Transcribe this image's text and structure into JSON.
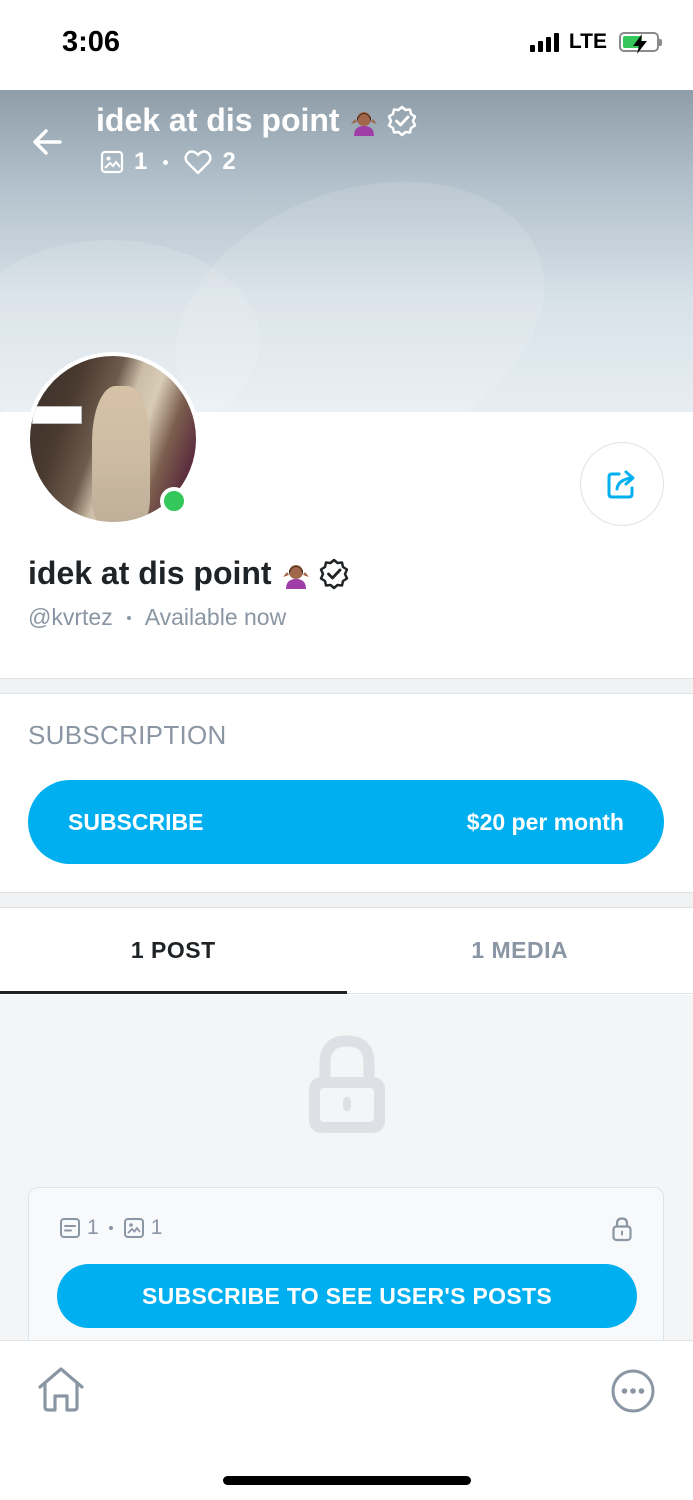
{
  "status_bar": {
    "time": "3:06",
    "network": "LTE",
    "battery_level": 0.6,
    "battery_color": "#35c759"
  },
  "header": {
    "back_icon": "arrow-left-icon",
    "title": "idek at dis point",
    "title_emoji": "person-shrugging-emoji",
    "verified_icon": "verified-badge-icon",
    "media_icon": "image-icon",
    "media_count": "1",
    "likes_icon": "heart-icon",
    "likes_count": "2"
  },
  "profile": {
    "name": "idek at dis point",
    "handle": "@kvrtez",
    "availability": "Available now",
    "online_color": "#34c759",
    "share_icon": "share-icon"
  },
  "subscription": {
    "heading": "SUBSCRIPTION",
    "button_label": "SUBSCRIBE",
    "price": "$20 per month",
    "accent_color": "#00aff0"
  },
  "tabs": [
    {
      "label": "1 POST",
      "active": true
    },
    {
      "label": "1 MEDIA",
      "active": false
    }
  ],
  "locked_content": {
    "lock_icon": "lock-icon",
    "posts_icon": "post-icon",
    "posts_count": "1",
    "media_icon": "image-icon",
    "media_count": "1",
    "cta_label": "SUBSCRIBE TO SEE USER'S POSTS"
  },
  "bottom_nav": {
    "home_icon": "home-icon",
    "more_icon": "more-icon"
  }
}
